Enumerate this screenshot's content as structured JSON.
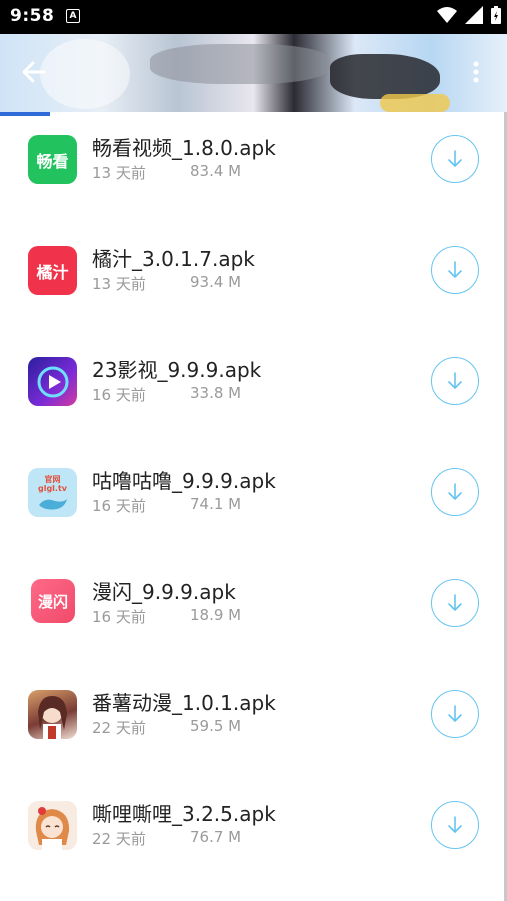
{
  "status_bar": {
    "time": "9:58",
    "notification_badge": "A",
    "icons": [
      "wifi-icon",
      "signal-icon",
      "battery-icon"
    ]
  },
  "header": {
    "back_icon": "arrow-back-icon",
    "more_icon": "more-vertical-icon"
  },
  "colors": {
    "accent_tab": "#2f6bd9",
    "download_ring": "#66c5f0"
  },
  "items": [
    {
      "name": "畅看视频_1.8.0.apk",
      "time": "13 天前",
      "size": "83.4 M",
      "icon_text": "畅看",
      "icon_color": "#22c35e",
      "download_icon": "download-arrow-icon"
    },
    {
      "name": "橘汁_3.0.1.7.apk",
      "time": "13 天前",
      "size": "93.4 M",
      "icon_text": "橘汁",
      "icon_color": "#f0334a",
      "download_icon": "download-arrow-icon"
    },
    {
      "name": "23影视_9.9.9.apk",
      "time": "16 天前",
      "size": "33.8 M",
      "icon_text": "",
      "icon_color": "#3b2bb8",
      "download_icon": "download-arrow-icon"
    },
    {
      "name": "咕噜咕噜_9.9.9.apk",
      "time": "16 天前",
      "size": "74.1 M",
      "icon_text": "官网\nglgl.tv",
      "icon_color": "#a9ddf2",
      "download_icon": "download-arrow-icon"
    },
    {
      "name": "漫闪_9.9.9.apk",
      "time": "16 天前",
      "size": "18.9 M",
      "icon_text": "漫闪",
      "icon_color": "#f25f7a",
      "download_icon": "download-arrow-icon"
    },
    {
      "name": "番薯动漫_1.0.1.apk",
      "time": "22 天前",
      "size": "59.5 M",
      "icon_text": "",
      "icon_color": "#c77a6b",
      "download_icon": "download-arrow-icon"
    },
    {
      "name": "嘶哩嘶哩_3.2.5.apk",
      "time": "22 天前",
      "size": "76.7 M",
      "icon_text": "",
      "icon_color": "#e8c6b2",
      "download_icon": "download-arrow-icon"
    }
  ]
}
